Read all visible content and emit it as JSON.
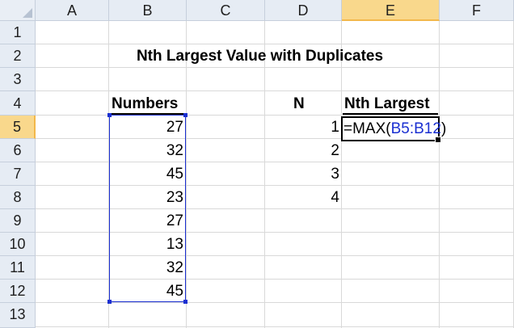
{
  "columns": [
    "A",
    "B",
    "C",
    "D",
    "E",
    "F"
  ],
  "rows": [
    "1",
    "2",
    "3",
    "4",
    "5",
    "6",
    "7",
    "8",
    "9",
    "10",
    "11",
    "12",
    "13"
  ],
  "title": "Nth Largest Value with Duplicates",
  "numbers_header": "Numbers",
  "numbers": [
    "27",
    "32",
    "45",
    "23",
    "27",
    "13",
    "32",
    "45"
  ],
  "n_header": "N",
  "n_values": [
    "1",
    "2",
    "3",
    "4"
  ],
  "nth_header": "Nth Largest",
  "formula": {
    "prefix": "=MAX(",
    "range": "B5:B12",
    "suffix": ")"
  },
  "active_cell": "E5",
  "selected_range": "B5:B12",
  "colors": {
    "range_highlight": "#1a2fd1",
    "header_selected": "#f9d88c"
  }
}
